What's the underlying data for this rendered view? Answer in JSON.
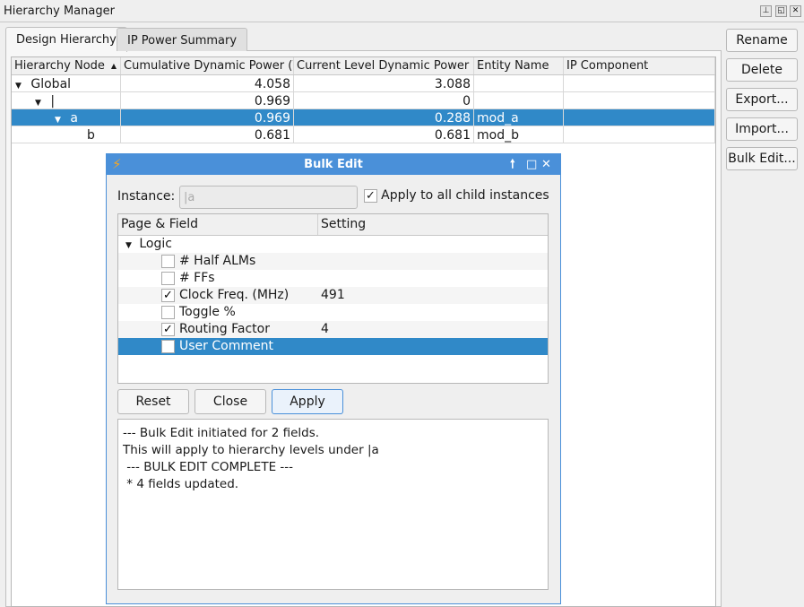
{
  "window": {
    "title": "Hierarchy Manager",
    "pin": "⊥",
    "float": "◱",
    "close": "✕"
  },
  "tabs": [
    {
      "label": "Design Hierarchy",
      "active": true
    },
    {
      "label": "IP Power Summary",
      "active": false
    }
  ],
  "table": {
    "columns": [
      "Hierarchy Node",
      "Cumulative Dynamic Power (W)",
      "Current Level Dynamic Power (W)",
      "Entity Name",
      "IP Component"
    ],
    "sort_indicator": "▲",
    "rows": [
      {
        "node": "Global",
        "cum": "4.058",
        "cur": "3.088",
        "entity": "",
        "ip": "",
        "expanded": true,
        "level": 0
      },
      {
        "node": "|",
        "cum": "0.969",
        "cur": "0",
        "entity": "",
        "ip": "",
        "expanded": true,
        "level": 1
      },
      {
        "node": "a",
        "cum": "0.969",
        "cur": "0.288",
        "entity": "mod_a",
        "ip": "",
        "expanded": true,
        "level": 2,
        "selected": true
      },
      {
        "node": "b",
        "cum": "0.681",
        "cur": "0.681",
        "entity": "mod_b",
        "ip": "",
        "level": 3
      }
    ]
  },
  "side_buttons": [
    "Rename",
    "Delete",
    "Export...",
    "Import...",
    "Bulk Edit..."
  ],
  "dialog": {
    "title": "Bulk Edit",
    "instance_label": "Instance:",
    "instance_value": "|a",
    "apply_all_label": "Apply to all child instances",
    "apply_all_checked": true,
    "tree_columns": [
      "Page & Field",
      "Setting"
    ],
    "group": "Logic",
    "fields": [
      {
        "label": "# Half ALMs",
        "checked": false,
        "setting": ""
      },
      {
        "label": "# FFs",
        "checked": false,
        "setting": ""
      },
      {
        "label": "Clock Freq. (MHz)",
        "checked": true,
        "setting": "491"
      },
      {
        "label": "Toggle %",
        "checked": false,
        "setting": ""
      },
      {
        "label": "Routing Factor",
        "checked": true,
        "setting": "4"
      },
      {
        "label": "User Comment",
        "checked": false,
        "setting": "",
        "selected": true
      }
    ],
    "buttons": {
      "reset": "Reset",
      "close": "Close",
      "apply": "Apply"
    },
    "log": "--- Bulk Edit initiated for 2 fields.\nThis will apply to hierarchy levels under |a\n --- BULK EDIT COMPLETE ---\n * 4 fields updated.",
    "accent": "#4a90d9",
    "selection": "#3089c8"
  }
}
